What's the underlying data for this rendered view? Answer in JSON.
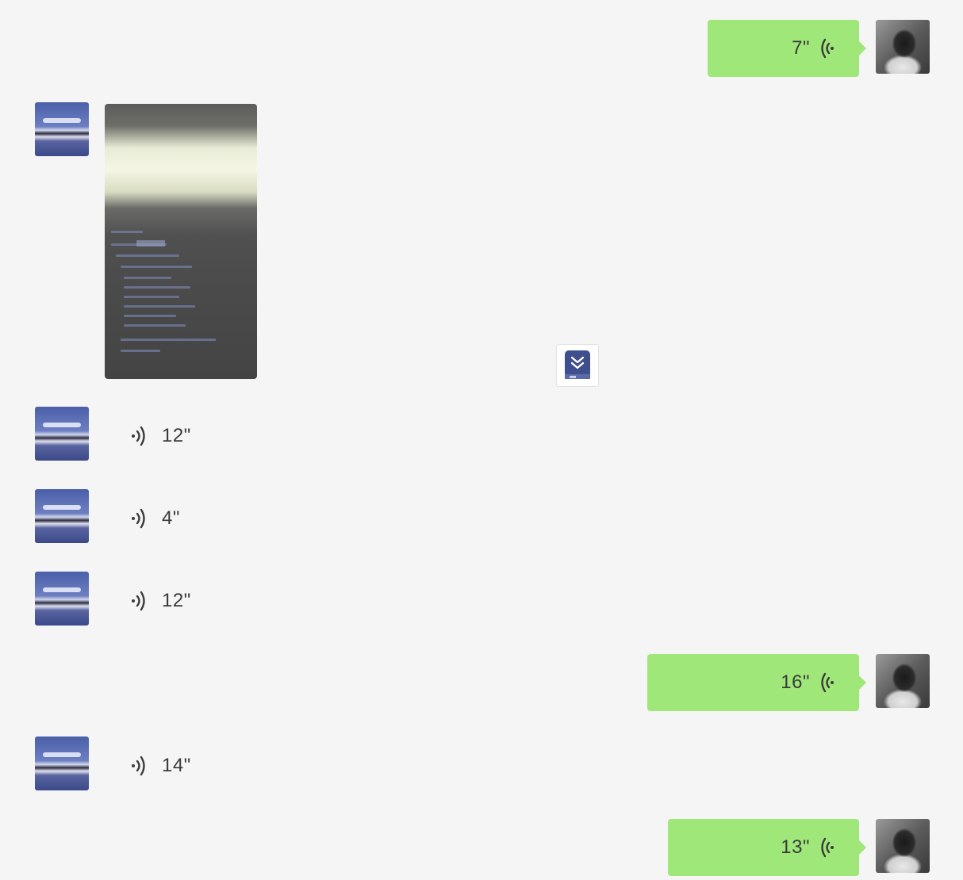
{
  "messages": [
    {
      "sender": "self",
      "type": "voice",
      "duration": "7\""
    },
    {
      "sender": "other",
      "type": "image"
    },
    {
      "sender": "other",
      "type": "voice",
      "duration": "12\""
    },
    {
      "sender": "other",
      "type": "voice",
      "duration": "4\""
    },
    {
      "sender": "other",
      "type": "voice",
      "duration": "12\""
    },
    {
      "sender": "self",
      "type": "voice",
      "duration": "16\""
    },
    {
      "sender": "other",
      "type": "voice",
      "duration": "14\""
    },
    {
      "sender": "self",
      "type": "voice",
      "duration": "13\""
    }
  ],
  "icons": {
    "voice": "voice-wave-icon",
    "floating": "bookmark-download-icon"
  },
  "colors": {
    "background": "#f5f5f5",
    "self_bubble": "#a0e77a",
    "floating_icon": "#3f4e8c"
  }
}
